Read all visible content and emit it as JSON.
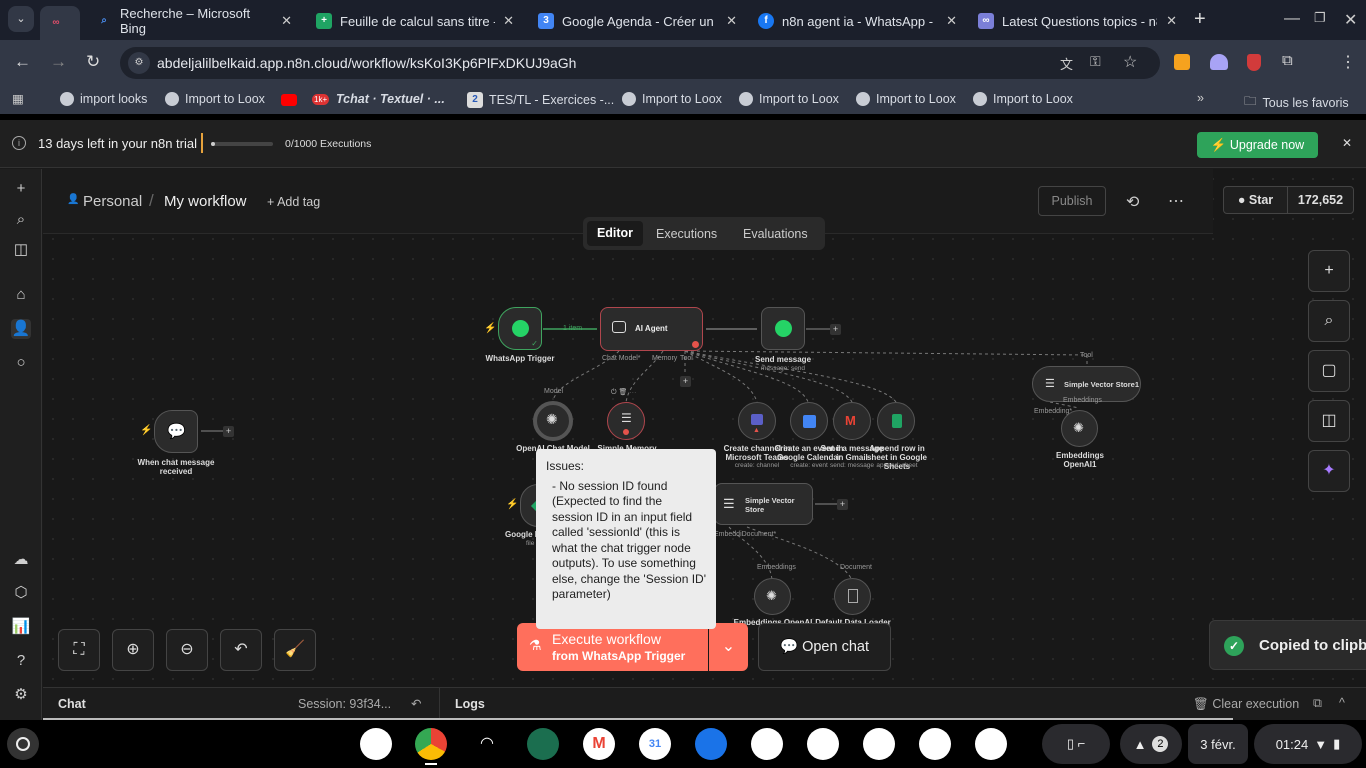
{
  "browser": {
    "tabs": [
      {
        "title": "Recherche – Microsoft Bing",
        "icon": "bing-search-icon"
      },
      {
        "title": "Feuille de calcul sans titre -",
        "icon": "google-sheets-icon"
      },
      {
        "title": "Google Agenda - Créer un é",
        "icon": "google-calendar-icon"
      },
      {
        "title": "n8n agent ia - WhatsApp - M",
        "icon": "facebook-icon"
      },
      {
        "title": "Latest Questions topics - n8",
        "icon": "n8n-icon"
      }
    ],
    "url": "abdeljalilbelkaid.app.n8n.cloud/workflow/ksKoI3Kp6PlFxDKUJ9aGh",
    "bookmarks": [
      "import looks",
      "Import to Loox",
      "Tchat · Textuel · ...",
      "TES/TL - Exercices -...",
      "Import to Loox",
      "Import to Loox",
      "Import to Loox",
      "Import to Loox"
    ],
    "youtube_badge": "1k+",
    "all_bookmarks": "Tous les favoris"
  },
  "banner": {
    "trial": "13 days left in your n8n trial",
    "executions": "0/1000 Executions",
    "executions_used_fraction": 0,
    "upgrade": "Upgrade now"
  },
  "header": {
    "project": "Personal",
    "workflow": "My workflow",
    "add_tag": "+ Add tag",
    "publish": "Publish",
    "star": "Star",
    "star_count": "172,652",
    "tabs": [
      "Editor",
      "Executions",
      "Evaluations"
    ],
    "active_tab": "Editor"
  },
  "nodes": {
    "chat_trigger": "When chat message received",
    "whatsapp_trigger": "WhatsApp Trigger",
    "edge_label": "1 item",
    "ai_agent": "AI Agent",
    "send_message": "Send message",
    "send_message_sub": "message: send",
    "agent_ports": [
      "Chat Model*",
      "Memory",
      "Tool"
    ],
    "model_port": "Model",
    "openai_chat": "OpenAI Chat Model",
    "simple_memory": "Simple Memory",
    "teams": "Create channel in Microsoft Teams",
    "teams_sub": "create: channel",
    "gcal": "Create an event in Google Calendar",
    "gcal_sub": "create: event",
    "gmail": "Send a message in Gmail",
    "gmail_sub": "send: message",
    "gsheets": "Append row in sheet in Google Sheets",
    "gsheets_sub": "append: sheet",
    "vector_store1": "Simple Vector Store1",
    "vs1_tool_port": "Tool",
    "vs1_embedding_port": "Embedding*",
    "vs1_embeddings_label": "Embeddings",
    "embeddings_openai1": "Embeddings OpenAI1",
    "google_drive": "Google D",
    "google_drive_sub": "file",
    "vector_store": "Simple Vector Store",
    "vs_ports": "EmbeddiDocument*",
    "embeddings_label": "Embeddings",
    "document_label": "Document",
    "embeddings_openai": "Embeddings OpenAI",
    "default_loader": "Default Data Loader"
  },
  "tooltip": {
    "title": "Issues:",
    "body": "- No session ID found (Expected to find the session ID in an input field called 'sessionId' (this is what the chat trigger node outputs). To use something else, change the 'Session ID' parameter)"
  },
  "execute": {
    "label": "Execute workflow",
    "sub": "from WhatsApp Trigger"
  },
  "open_chat": "Open chat",
  "toast": "Copied to clipb",
  "bottom": {
    "chat": "Chat",
    "session": "Session: 93f34...",
    "logs": "Logs",
    "clear": "Clear execution"
  },
  "shelf": {
    "date": "3 févr.",
    "time": "01:24",
    "notifications": "2"
  }
}
